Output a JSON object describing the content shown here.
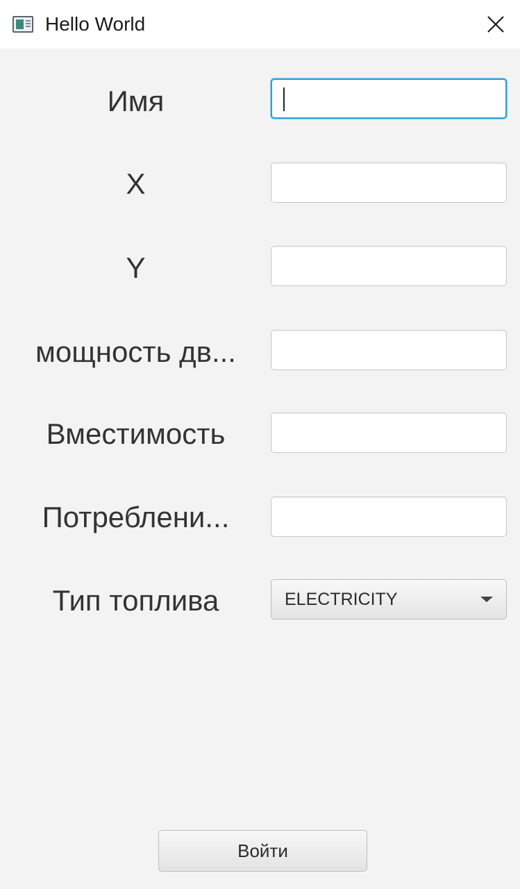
{
  "window": {
    "title": "Hello World"
  },
  "form": {
    "fields": [
      {
        "label": "Имя",
        "value": ""
      },
      {
        "label": "X",
        "value": ""
      },
      {
        "label": "Y",
        "value": ""
      },
      {
        "label": "мощность дв...",
        "value": ""
      },
      {
        "label": "Вместимость",
        "value": ""
      },
      {
        "label": "Потреблени...",
        "value": ""
      }
    ],
    "fuel_type": {
      "label": "Тип топлива",
      "selected": "ELECTRICITY"
    },
    "submit_label": "Войти"
  },
  "colors": {
    "focus_border": "#2a9fd8",
    "background": "#f3f3f3"
  }
}
